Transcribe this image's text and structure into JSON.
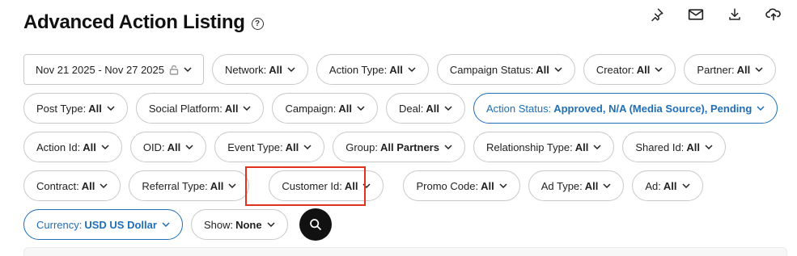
{
  "page": {
    "title": "Advanced Action Listing",
    "help_icon": "?"
  },
  "toolbar": {
    "icons": [
      "pin-icon",
      "mail-icon",
      "download-icon",
      "cloud-sync-icon"
    ]
  },
  "filters": {
    "date_range": "Nov 21 2025 - Nov 27 2025",
    "row1": [
      {
        "label": "Network:",
        "value": "All"
      },
      {
        "label": "Action Type:",
        "value": "All"
      },
      {
        "label": "Campaign Status:",
        "value": "All"
      },
      {
        "label": "Creator:",
        "value": "All"
      },
      {
        "label": "Partner:",
        "value": "All"
      }
    ],
    "row2": [
      {
        "label": "Post Type:",
        "value": "All"
      },
      {
        "label": "Social Platform:",
        "value": "All"
      },
      {
        "label": "Campaign:",
        "value": "All"
      },
      {
        "label": "Deal:",
        "value": "All"
      },
      {
        "label": "Action Status:",
        "value": "Approved, N/A (Media Source), Pending"
      }
    ],
    "row3": [
      {
        "label": "Action Id:",
        "value": "All"
      },
      {
        "label": "OID:",
        "value": "All"
      },
      {
        "label": "Event Type:",
        "value": "All"
      },
      {
        "label": "Group:",
        "value": "All Partners"
      },
      {
        "label": "Relationship Type:",
        "value": "All"
      },
      {
        "label": "Shared Id:",
        "value": "All"
      }
    ],
    "row4": [
      {
        "label": "Contract:",
        "value": "All"
      },
      {
        "label": "Referral Type:",
        "value": "All"
      },
      {
        "label": "Customer Id:",
        "value": "All"
      },
      {
        "label": "Promo Code:",
        "value": "All"
      },
      {
        "label": "Ad Type:",
        "value": "All"
      },
      {
        "label": "Ad:",
        "value": "All"
      }
    ],
    "row5": [
      {
        "label": "Currency:",
        "value": "USD US Dollar"
      },
      {
        "label": "Show:",
        "value": "None"
      }
    ]
  },
  "colors": {
    "accent": "#1f6fb8",
    "highlight": "#e0321c",
    "search_button": "#111111"
  }
}
